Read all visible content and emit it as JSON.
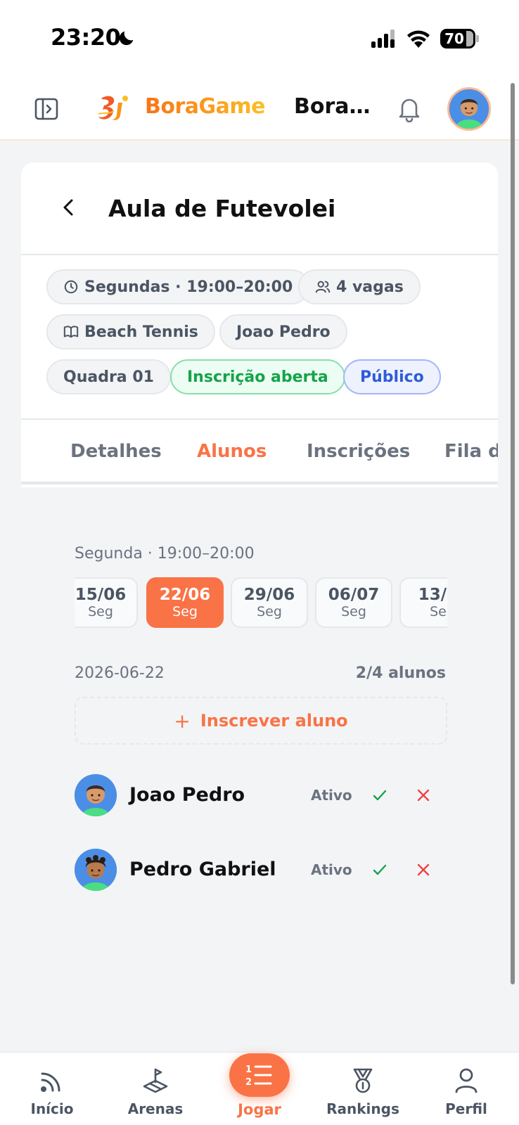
{
  "status_bar": {
    "time": "23:20",
    "battery": "70"
  },
  "header": {
    "brand": "BoraGame",
    "title": "Bora..."
  },
  "card": {
    "title": "Aula de Futevolei",
    "chips": {
      "schedule": "Segundas · 19:00–20:00",
      "spots": "4 vagas",
      "sport": "Beach Tennis",
      "teacher": "Joao Pedro",
      "court": "Quadra 01",
      "registration": "Inscrição aberta",
      "visibility": "Público"
    },
    "tabs": [
      "Detalhes",
      "Alunos",
      "Inscrições",
      "Fila d"
    ],
    "active_tab": "Alunos"
  },
  "students_panel": {
    "session_label": "Segunda · 19:00–20:00",
    "dates": [
      {
        "date": "15/06",
        "weekday": "Seg"
      },
      {
        "date": "22/06",
        "weekday": "Seg"
      },
      {
        "date": "29/06",
        "weekday": "Seg"
      },
      {
        "date": "06/07",
        "weekday": "Seg"
      },
      {
        "date": "13/0",
        "weekday": "Se"
      }
    ],
    "selected_date_index": 1,
    "selected_date": "2026-06-22",
    "count_label": "2/4 alunos",
    "enroll_button": "Inscrever aluno",
    "students": [
      {
        "name": "Joao Pedro",
        "status": "Ativo"
      },
      {
        "name": "Pedro Gabriel",
        "status": "Ativo"
      }
    ]
  },
  "bottom_nav": {
    "items": [
      "Início",
      "Arenas",
      "Jogar",
      "Rankings",
      "Perfil"
    ],
    "active": "Jogar"
  },
  "colors": {
    "accent": "#f97346",
    "green": "#16a34a",
    "blue": "#2f5cd8",
    "red": "#ef4444"
  }
}
